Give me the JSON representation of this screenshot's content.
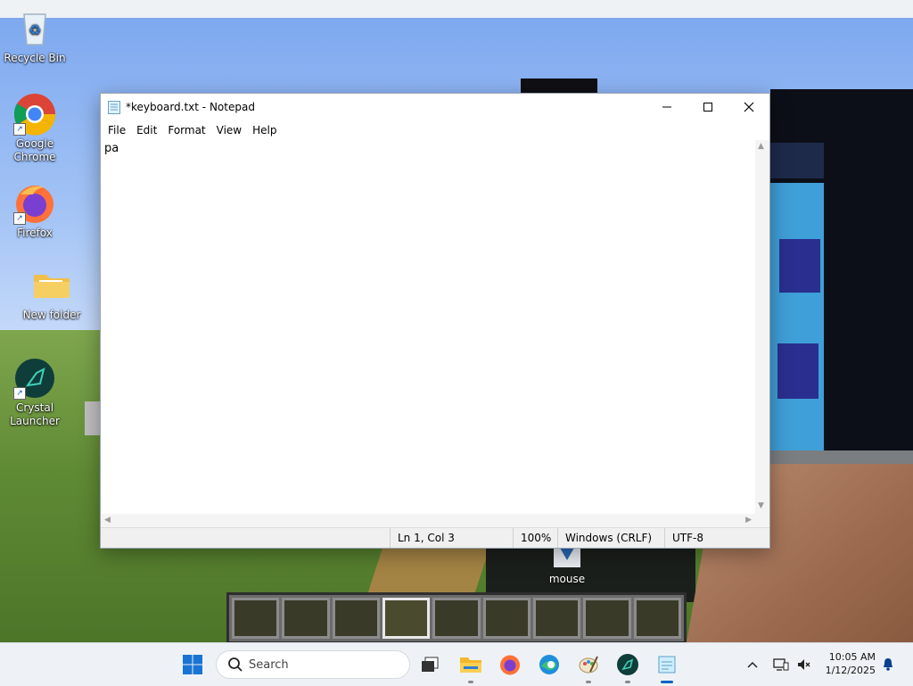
{
  "desktop": {
    "icons": [
      {
        "label": "Recycle Bin"
      },
      {
        "label": "Google Chrome"
      },
      {
        "label": "Firefox"
      },
      {
        "label": "New folder"
      },
      {
        "label": "Crystal Launcher"
      }
    ],
    "mouse_item_label": "mouse"
  },
  "notepad": {
    "title": "*keyboard.txt - Notepad",
    "menu": [
      "File",
      "Edit",
      "Format",
      "View",
      "Help"
    ],
    "content": "pa",
    "status": {
      "position": "Ln 1, Col 3",
      "zoom": "100%",
      "line_ending": "Windows (CRLF)",
      "encoding": "UTF-8"
    }
  },
  "hotbar": {
    "slots": 9,
    "selected_slot": 4
  },
  "taskbar": {
    "search_placeholder": "Search",
    "apps": [
      "start-icon",
      "task-view-icon",
      "file-explorer-icon",
      "firefox-icon",
      "edge-icon",
      "paint-icon",
      "crystal-launcher-icon",
      "notepad-icon"
    ],
    "time": "10:05 AM",
    "date": "1/12/2025"
  }
}
